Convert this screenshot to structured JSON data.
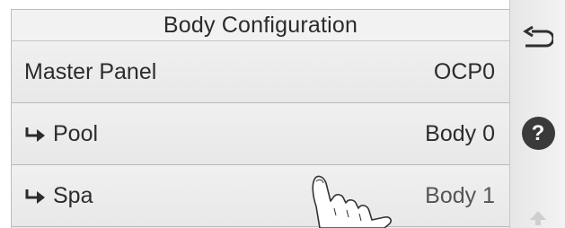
{
  "screen": {
    "title": "Body Configuration"
  },
  "rows": [
    {
      "label": "Master Panel",
      "value": "OCP0"
    },
    {
      "label": "Pool",
      "value": "Body 0"
    },
    {
      "label": "Spa",
      "value": "Body 1"
    }
  ],
  "sidebar": {
    "back_icon": "back-arrow-icon",
    "help_label": "?",
    "help_icon": "help-icon",
    "up_icon": "up-arrow-icon"
  },
  "colors": {
    "panel_bg": "#eeeeee",
    "text": "#2c2c2c",
    "help_circle": "#3a3a3a"
  }
}
